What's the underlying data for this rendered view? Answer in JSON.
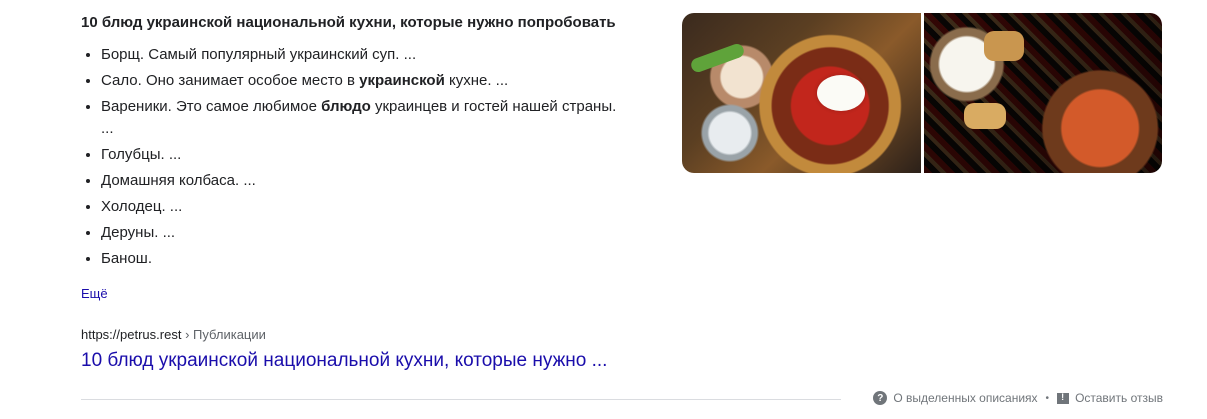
{
  "snippet": {
    "title": "10 блюд украинской национальной кухни, которые нужно попробовать",
    "items": [
      {
        "pre": "Борщ. Самый популярный украинский суп. ...",
        "bold": "",
        "post": ""
      },
      {
        "pre": "Сало. Оно занимает особое место в ",
        "bold": "украинской",
        "post": " кухне. ..."
      },
      {
        "pre": "Вареники. Это самое любимое ",
        "bold": "блюдо",
        "post": " украинцев и гостей нашей страны. ..."
      },
      {
        "pre": "Голубцы. ...",
        "bold": "",
        "post": ""
      },
      {
        "pre": "Домашняя колбаса. ...",
        "bold": "",
        "post": ""
      },
      {
        "pre": "Холодец. ...",
        "bold": "",
        "post": ""
      },
      {
        "pre": "Деруны. ...",
        "bold": "",
        "post": ""
      },
      {
        "pre": "Банош.",
        "bold": "",
        "post": ""
      }
    ],
    "more_label": "Ещё"
  },
  "result": {
    "url": "https://petrus.rest",
    "separator": "›",
    "breadcrumb": "Публикации",
    "title": "10 блюд украинской национальной кухни, которые нужно ..."
  },
  "footer": {
    "about_label": "О выделенных описаниях",
    "dot": "•",
    "feedback_label": "Оставить отзыв",
    "about_icon": "help-circle-icon",
    "feedback_icon": "feedback-icon"
  },
  "images": [
    {
      "semantic": "borscht-with-sour-cream-photo"
    },
    {
      "semantic": "ukrainian-table-spread-photo"
    }
  ],
  "colors": {
    "link": "#1a0dab",
    "text": "#202124",
    "muted": "#70757a"
  }
}
